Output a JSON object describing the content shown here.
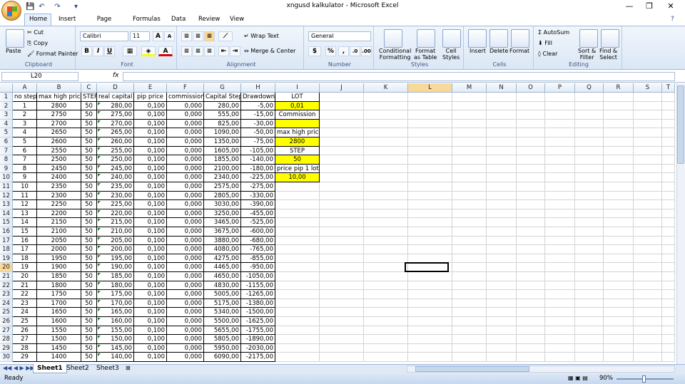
{
  "window": {
    "title": "xngusd kalkulator - Microsoft Excel"
  },
  "qat": {
    "save": "💾",
    "undo": "↶",
    "redo": "↷",
    "more": "▾"
  },
  "tabs": [
    "Home",
    "Insert",
    "Page Layout",
    "Formulas",
    "Data",
    "Review",
    "View"
  ],
  "ribbon": {
    "clipboard": {
      "paste": "Paste",
      "cut": "Cut",
      "copy": "Copy",
      "format_painter": "Format Painter",
      "label": "Clipboard"
    },
    "font": {
      "name": "Calibri",
      "size": "11",
      "label": "Font",
      "bold": "B",
      "italic": "I",
      "underline": "U"
    },
    "alignment": {
      "wrap": "Wrap Text",
      "merge": "Merge & Center",
      "label": "Alignment"
    },
    "number": {
      "format": "General",
      "label": "Number",
      "percent": "%"
    },
    "styles": {
      "conditional": "Conditional",
      "conditional2": "Formatting",
      "format_table": "Format",
      "format_table2": "as Table",
      "cell_styles": "Cell",
      "cell_styles2": "Styles",
      "label": "Styles"
    },
    "cells": {
      "insert": "Insert",
      "delete": "Delete",
      "format": "Format",
      "label": "Cells"
    },
    "editing": {
      "autosum": "AutoSum",
      "fill": "Fill",
      "clear": "Clear",
      "sort": "Sort &",
      "sort2": "Filter",
      "find": "Find &",
      "find2": "Select",
      "label": "Editing"
    }
  },
  "formula_bar": {
    "name_box": "L20",
    "fx": "fx",
    "value": ""
  },
  "columns": [
    "A",
    "B",
    "C",
    "D",
    "E",
    "F",
    "G",
    "H",
    "I",
    "J",
    "K",
    "L",
    "M",
    "N",
    "O",
    "P",
    "Q",
    "R",
    "S",
    "T"
  ],
  "row_numbers": [
    "1",
    "2",
    "3",
    "4",
    "5",
    "6",
    "7",
    "8",
    "9",
    "10",
    "11",
    "12",
    "13",
    "14",
    "15",
    "16",
    "17",
    "18",
    "19",
    "20",
    "21",
    "22",
    "23",
    "24",
    "25",
    "26",
    "27",
    "28",
    "29",
    "30"
  ],
  "headers": [
    "no step",
    "max high price",
    "STEP",
    "real capital",
    "pip price",
    "commission",
    "Capital Step",
    "Drawdown"
  ],
  "rows": [
    [
      "1",
      "2800",
      "50",
      "280,00",
      "0,100",
      "0,000",
      "280,00",
      "-5,00"
    ],
    [
      "2",
      "2750",
      "50",
      "275,00",
      "0,100",
      "0,000",
      "555,00",
      "-15,00"
    ],
    [
      "3",
      "2700",
      "50",
      "270,00",
      "0,100",
      "0,000",
      "825,00",
      "-30,00"
    ],
    [
      "4",
      "2650",
      "50",
      "265,00",
      "0,100",
      "0,000",
      "1090,00",
      "-50,00"
    ],
    [
      "5",
      "2600",
      "50",
      "260,00",
      "0,100",
      "0,000",
      "1350,00",
      "-75,00"
    ],
    [
      "6",
      "2550",
      "50",
      "255,00",
      "0,100",
      "0,000",
      "1605,00",
      "-105,00"
    ],
    [
      "7",
      "2500",
      "50",
      "250,00",
      "0,100",
      "0,000",
      "1855,00",
      "-140,00"
    ],
    [
      "8",
      "2450",
      "50",
      "245,00",
      "0,100",
      "0,000",
      "2100,00",
      "-180,00"
    ],
    [
      "9",
      "2400",
      "50",
      "240,00",
      "0,100",
      "0,000",
      "2340,00",
      "-225,00"
    ],
    [
      "10",
      "2350",
      "50",
      "235,00",
      "0,100",
      "0,000",
      "2575,00",
      "-275,00"
    ],
    [
      "11",
      "2300",
      "50",
      "230,00",
      "0,100",
      "0,000",
      "2805,00",
      "-330,00"
    ],
    [
      "12",
      "2250",
      "50",
      "225,00",
      "0,100",
      "0,000",
      "3030,00",
      "-390,00"
    ],
    [
      "13",
      "2200",
      "50",
      "220,00",
      "0,100",
      "0,000",
      "3250,00",
      "-455,00"
    ],
    [
      "14",
      "2150",
      "50",
      "215,00",
      "0,100",
      "0,000",
      "3465,00",
      "-525,00"
    ],
    [
      "15",
      "2100",
      "50",
      "210,00",
      "0,100",
      "0,000",
      "3675,00",
      "-600,00"
    ],
    [
      "16",
      "2050",
      "50",
      "205,00",
      "0,100",
      "0,000",
      "3880,00",
      "-680,00"
    ],
    [
      "17",
      "2000",
      "50",
      "200,00",
      "0,100",
      "0,000",
      "4080,00",
      "-765,00"
    ],
    [
      "18",
      "1950",
      "50",
      "195,00",
      "0,100",
      "0,000",
      "4275,00",
      "-855,00"
    ],
    [
      "19",
      "1900",
      "50",
      "190,00",
      "0,100",
      "0,000",
      "4465,00",
      "-950,00"
    ],
    [
      "20",
      "1850",
      "50",
      "185,00",
      "0,100",
      "0,000",
      "4650,00",
      "-1050,00"
    ],
    [
      "21",
      "1800",
      "50",
      "180,00",
      "0,100",
      "0,000",
      "4830,00",
      "-1155,00"
    ],
    [
      "22",
      "1750",
      "50",
      "175,00",
      "0,100",
      "0,000",
      "5005,00",
      "-1265,00"
    ],
    [
      "23",
      "1700",
      "50",
      "170,00",
      "0,100",
      "0,000",
      "5175,00",
      "-1380,00"
    ],
    [
      "24",
      "1650",
      "50",
      "165,00",
      "0,100",
      "0,000",
      "5340,00",
      "-1500,00"
    ],
    [
      "25",
      "1600",
      "50",
      "160,00",
      "0,100",
      "0,000",
      "5500,00",
      "-1625,00"
    ],
    [
      "26",
      "1550",
      "50",
      "155,00",
      "0,100",
      "0,000",
      "5655,00",
      "-1755,00"
    ],
    [
      "27",
      "1500",
      "50",
      "150,00",
      "0,100",
      "0,000",
      "5805,00",
      "-1890,00"
    ],
    [
      "28",
      "1450",
      "50",
      "145,00",
      "0,100",
      "0,000",
      "5950,00",
      "-2030,00"
    ],
    [
      "29",
      "1400",
      "50",
      "140,00",
      "0,100",
      "0,000",
      "6090,00",
      "-2175,00"
    ]
  ],
  "params": [
    {
      "text": "LOT",
      "yellow": false
    },
    {
      "text": "0,01",
      "yellow": true
    },
    {
      "text": "Commission",
      "yellow": false
    },
    {
      "text": "",
      "yellow": true
    },
    {
      "text": "max high price",
      "yellow": false
    },
    {
      "text": "2800",
      "yellow": true
    },
    {
      "text": "STEP",
      "yellow": false
    },
    {
      "text": "50",
      "yellow": true
    },
    {
      "text": "price pip 1 lot",
      "yellow": false
    },
    {
      "text": "10,00",
      "yellow": true
    }
  ],
  "sheets": [
    "Sheet1",
    "Sheet2",
    "Sheet3"
  ],
  "active_sheet": "Sheet1",
  "status": {
    "mode": "Ready",
    "zoom": "90%"
  }
}
